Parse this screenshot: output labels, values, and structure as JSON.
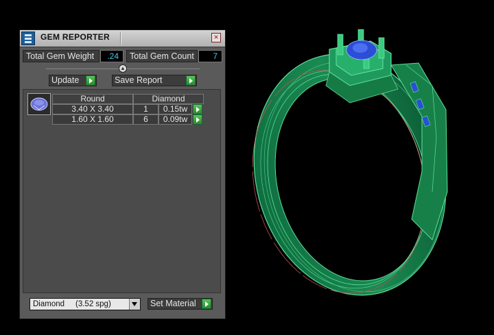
{
  "window": {
    "title": "GEM REPORTER",
    "close_glyph": "×"
  },
  "stats": {
    "weight_label": "Total Gem Weight",
    "weight_value": ".24",
    "count_label": "Total Gem Count",
    "count_value": "7"
  },
  "actions": {
    "update_label": "Update",
    "save_report_label": "Save Report"
  },
  "gem_table": {
    "shape_header": "Round",
    "material_header": "Diamond",
    "rows": [
      {
        "size": "3.40 X 3.40",
        "count": "1",
        "weight": "0.15tw"
      },
      {
        "size": "1.60 X 1.60",
        "count": "6",
        "weight": "0.09tw"
      }
    ]
  },
  "material": {
    "selected": "Diamond     (3.52 spg)",
    "set_material_label": "Set Material"
  },
  "colors": {
    "ring_green": "#1a8a52",
    "ring_wire": "#5fe09a",
    "gem_blue": "#2a4fd6",
    "stat_value": "#49c8f0",
    "action_green": "#3aa83a"
  },
  "icons": [
    "gem-reporter-icon",
    "close-icon",
    "slider-knob-icon",
    "arrow-right-icon",
    "gem-thumbnail-icon",
    "chevron-down-icon"
  ]
}
